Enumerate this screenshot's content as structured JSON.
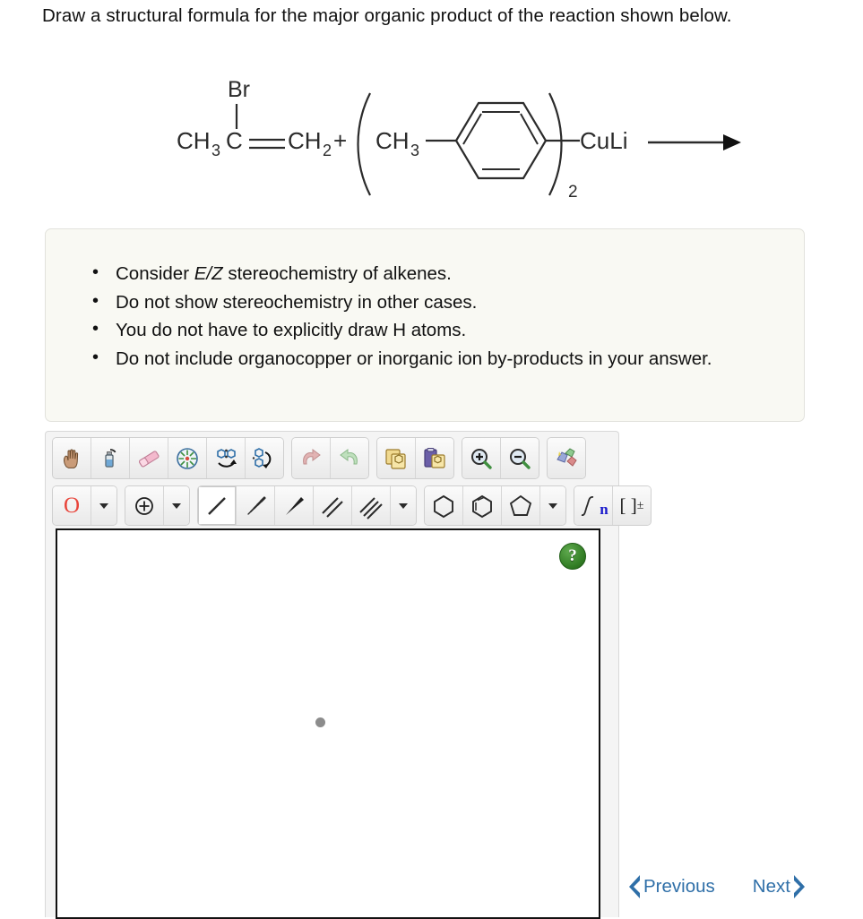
{
  "question": {
    "prompt": "Draw a structural formula for the major organic product of the reaction shown below."
  },
  "reaction": {
    "reactant1": {
      "name": "2-bromopropene",
      "labels": {
        "substituent": "Br",
        "left_group": "CH",
        "left_sub": "3",
        "center_atom": "C",
        "right_group": "CH",
        "right_sub": "2"
      }
    },
    "plus_sign": "+",
    "reactant2": {
      "name": "lithium bis(4-methylphenyl)cuprate",
      "labels": {
        "methyl": "CH",
        "methyl_sub": "3",
        "metal": "CuLi",
        "stoichiometry_subscript": "2"
      }
    },
    "arrow": "reaction-arrow"
  },
  "instructions": {
    "items": [
      {
        "pre": "Consider ",
        "emphasis": "E/Z",
        "post": " stereochemistry of alkenes."
      },
      {
        "pre": "Do not show stereochemistry in other cases.",
        "emphasis": "",
        "post": ""
      },
      {
        "pre": "You do not have to explicitly draw H atoms.",
        "emphasis": "",
        "post": ""
      },
      {
        "pre": "Do not include organocopper or inorganic ion by-products in your answer.",
        "emphasis": "",
        "post": ""
      }
    ]
  },
  "toolbar": {
    "row1": [
      {
        "name": "pan-hand-icon",
        "label": "Pan"
      },
      {
        "name": "eraser-spray-icon",
        "label": "Clear"
      },
      {
        "name": "eraser-icon",
        "label": "Erase"
      },
      {
        "name": "center-structure-icon",
        "label": "Center"
      },
      {
        "name": "flip-horizontal-icon",
        "label": "Flip horizontal"
      },
      {
        "name": "flip-vertical-icon",
        "label": "Flip vertical"
      },
      {
        "name": "undo-icon",
        "label": "Undo"
      },
      {
        "name": "redo-icon",
        "label": "Redo"
      },
      {
        "name": "copy-icon",
        "label": "Copy"
      },
      {
        "name": "paste-icon",
        "label": "Paste"
      },
      {
        "name": "zoom-in-icon",
        "label": "Zoom in"
      },
      {
        "name": "zoom-out-icon",
        "label": "Zoom out"
      },
      {
        "name": "clean-structure-icon",
        "label": "Clean up structure"
      }
    ],
    "row2": [
      {
        "name": "atom-oxygen-tool",
        "label": "O"
      },
      {
        "name": "atom-dropdown-caret",
        "label": ""
      },
      {
        "name": "charge-tool",
        "label": ""
      },
      {
        "name": "charge-dropdown-caret",
        "label": ""
      },
      {
        "name": "single-bond-tool",
        "label": "",
        "active": true
      },
      {
        "name": "hashed-wedge-bond-tool",
        "label": ""
      },
      {
        "name": "solid-wedge-bond-tool",
        "label": ""
      },
      {
        "name": "double-bond-tool",
        "label": ""
      },
      {
        "name": "triple-bond-tool",
        "label": ""
      },
      {
        "name": "bond-dropdown-caret",
        "label": ""
      },
      {
        "name": "cyclohexane-ring-tool",
        "label": ""
      },
      {
        "name": "benzene-ring-tool",
        "label": ""
      },
      {
        "name": "cyclopentane-ring-tool",
        "label": ""
      },
      {
        "name": "ring-dropdown-caret",
        "label": ""
      },
      {
        "name": "repeat-unit-tool",
        "label": "n"
      },
      {
        "name": "bracket-charge-tool",
        "label": "[ ]"
      }
    ],
    "bracket_tool_label": "[ ]",
    "bracket_tool_superscript": "±",
    "repeat_tool_label": "n",
    "oxygen_label": "O",
    "active_tool": "single-bond-tool"
  },
  "canvas": {
    "help_label": "?",
    "cursor_marker": "drawing-anchor-dot"
  },
  "navigation": {
    "previous_label": "Previous",
    "next_label": "Next"
  },
  "colors": {
    "oxygen_red": "#e8443a",
    "repeat_blue": "#1a1acc",
    "nav_blue": "#2f6fa8",
    "help_green": "#2f7a22",
    "instruction_bg": "#f9f9f3",
    "panel_bg": "#f4f4f4"
  }
}
